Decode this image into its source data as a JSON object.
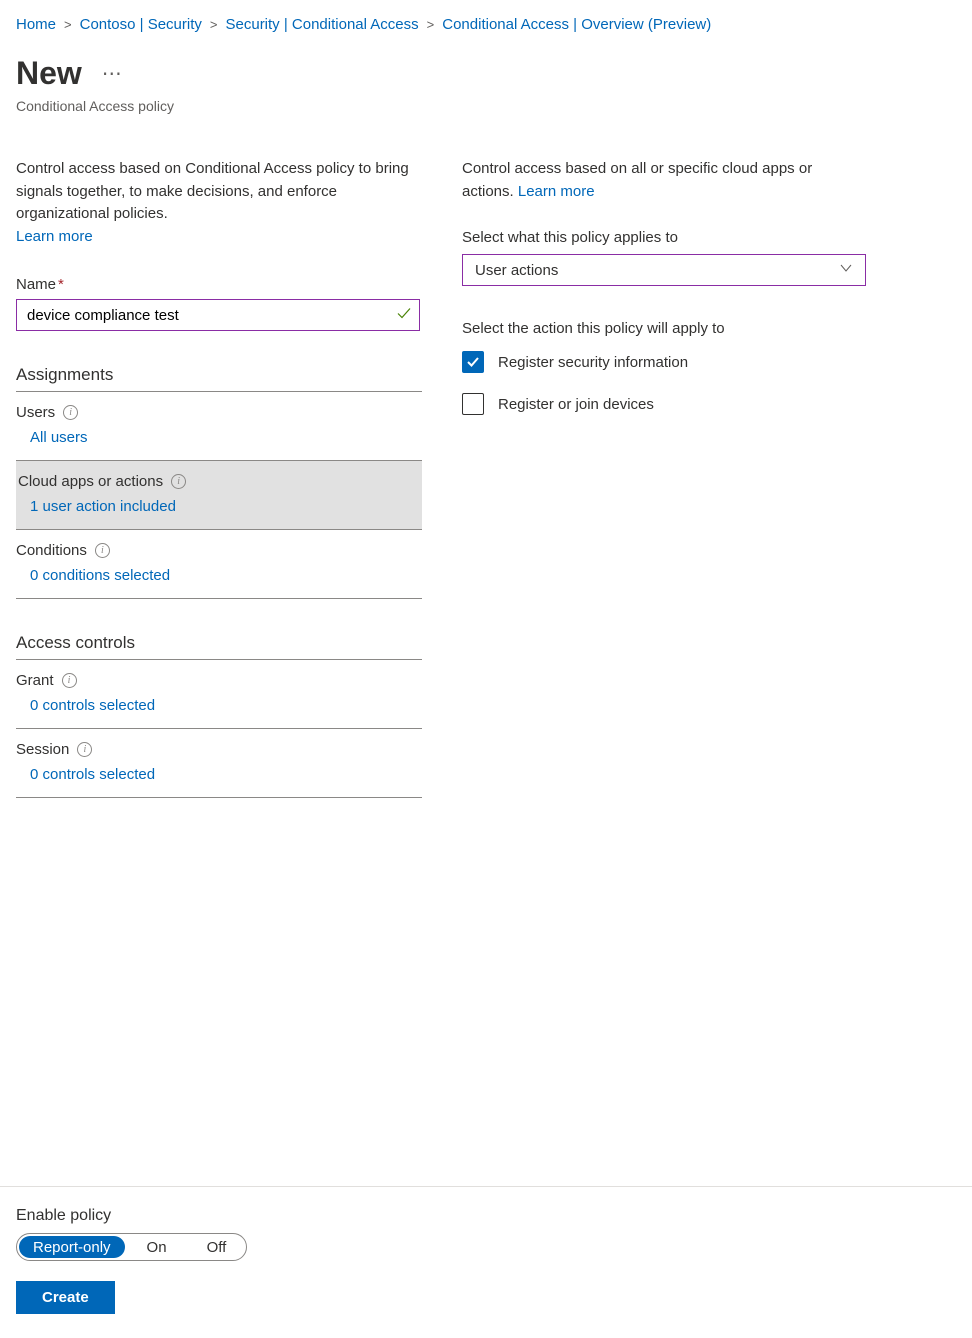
{
  "breadcrumb": [
    "Home",
    "Contoso | Security",
    "Security | Conditional Access",
    "Conditional Access | Overview (Preview)"
  ],
  "title": "New",
  "subtitle": "Conditional Access policy",
  "left": {
    "intro": "Control access based on Conditional Access policy to bring signals together, to make decisions, and enforce organizational policies.",
    "learn_more": "Learn more",
    "name_label": "Name",
    "name_value": "device compliance test",
    "assignments_header": "Assignments",
    "users": {
      "label": "Users",
      "value": "All users"
    },
    "cloud_apps": {
      "label": "Cloud apps or actions",
      "value": "1 user action included"
    },
    "conditions": {
      "label": "Conditions",
      "value": "0 conditions selected"
    },
    "access_controls_header": "Access controls",
    "grant": {
      "label": "Grant",
      "value": "0 controls selected"
    },
    "session": {
      "label": "Session",
      "value": "0 controls selected"
    }
  },
  "right": {
    "intro": "Control access based on all or specific cloud apps or actions.",
    "learn_more": "Learn more",
    "applies_label": "Select what this policy applies to",
    "applies_value": "User actions",
    "action_label": "Select the action this policy will apply to",
    "actions": [
      {
        "label": "Register security information",
        "checked": true
      },
      {
        "label": "Register or join devices",
        "checked": false
      }
    ]
  },
  "footer": {
    "enable_label": "Enable policy",
    "options": [
      "Report-only",
      "On",
      "Off"
    ],
    "selected": "Report-only",
    "create": "Create"
  }
}
